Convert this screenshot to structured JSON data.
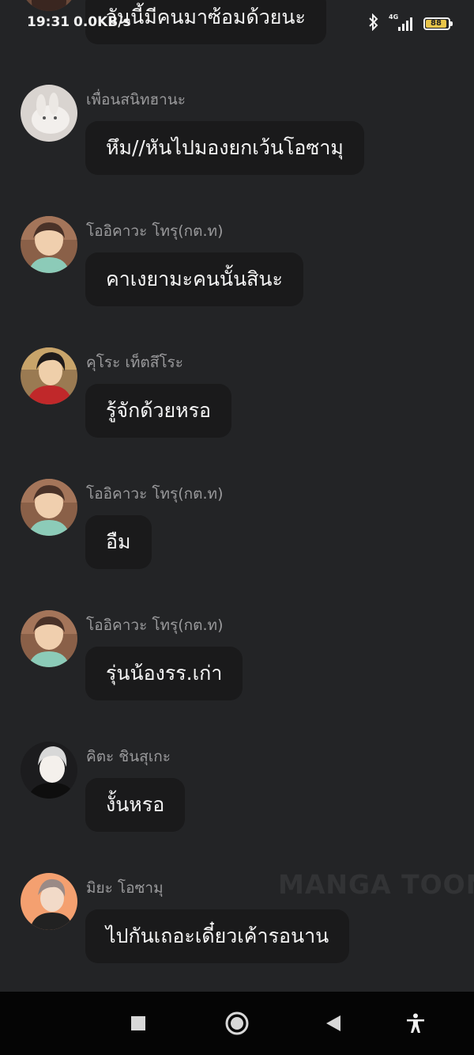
{
  "status_bar": {
    "time": "19:31",
    "speed": "0.0KB/s",
    "network": "4G",
    "battery": "88"
  },
  "messages": [
    {
      "sender": "",
      "text": "วันนี้มีคนมาซ้อมด้วยนะ",
      "avatar": "avatar-partial"
    },
    {
      "sender": "เพื่อนสนิทฮานะ",
      "text": "หึม//หันไปมองยกเว้นโอซามุ",
      "avatar": "white-rabbit-avatar"
    },
    {
      "sender": "โออิคาวะ โทรุ(กต.ท)",
      "text": "คาเงยามะคนนั้นสินะ",
      "avatar": "oikawa-avatar"
    },
    {
      "sender": "คุโระ เท็ตสึโระ",
      "text": "รู้จักด้วยหรอ",
      "avatar": "kuroo-avatar"
    },
    {
      "sender": "โออิคาวะ โทรุ(กต.ท)",
      "text": "อืม",
      "avatar": "oikawa-avatar"
    },
    {
      "sender": "โออิคาวะ โทรุ(กต.ท)",
      "text": "รุ่นน้องรร.เก่า",
      "avatar": "oikawa-avatar"
    },
    {
      "sender": "คิตะ ชินสุเกะ",
      "text": "งั้นหรอ",
      "avatar": "kita-avatar"
    },
    {
      "sender": "มิยะ โอซามุ",
      "text": "ไปกันเถอะเดี๋ยวเค้ารอนาน",
      "avatar": "osamu-avatar"
    }
  ],
  "watermark": "MANGA TOON",
  "nav": {
    "recent": "square-icon",
    "home": "circle-icon",
    "back": "triangle-back-icon",
    "accessibility": "accessibility-icon"
  }
}
